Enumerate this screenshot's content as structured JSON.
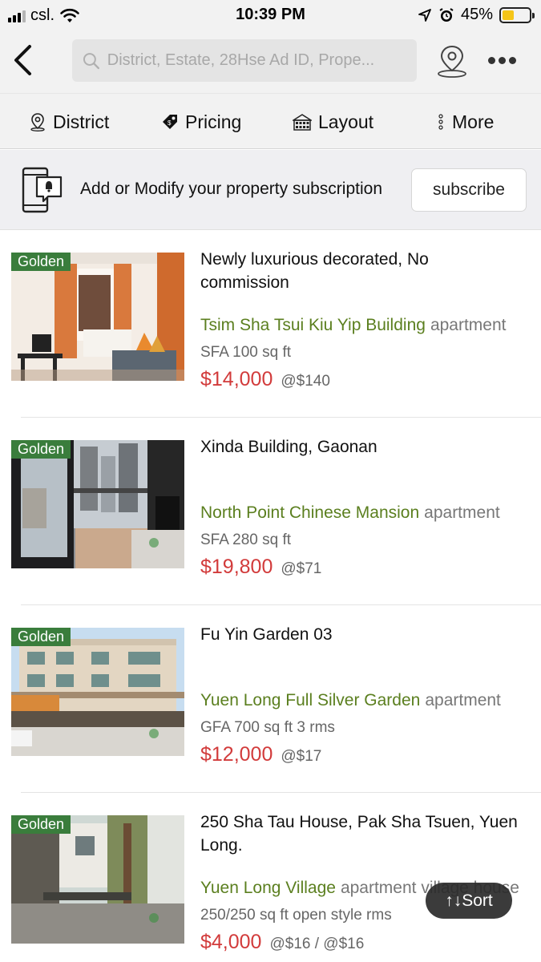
{
  "status_bar": {
    "carrier": "csl.",
    "time": "10:39 PM",
    "battery_percent_label": "45%",
    "battery_level": 0.45
  },
  "nav": {
    "search_placeholder": "District, Estate, 28Hse Ad ID, Prope..."
  },
  "filters": [
    {
      "label": "District",
      "icon": "location-pin-icon"
    },
    {
      "label": "Pricing",
      "icon": "price-tag-icon"
    },
    {
      "label": "Layout",
      "icon": "building-icon"
    },
    {
      "label": "More",
      "icon": "vertical-dots-icon"
    }
  ],
  "subscription": {
    "text": "Add or Modify your property subscription",
    "button_label": "subscribe"
  },
  "listings": [
    {
      "badge": "Golden",
      "title": "Newly luxurious decorated, No commission",
      "estate": "Tsim Sha Tsui Kiu Yip Building",
      "property_type": "apartment",
      "area": "SFA 100 sq ft",
      "price": "$14,000",
      "unit_price": "@$140"
    },
    {
      "badge": "Golden",
      "title": "Xinda Building, Gaonan",
      "estate": "North Point Chinese Mansion",
      "property_type": "apartment",
      "area": "SFA 280 sq ft",
      "price": "$19,800",
      "unit_price": "@$71"
    },
    {
      "badge": "Golden",
      "title": "Fu Yin Garden 03",
      "estate": "Yuen Long Full Silver Garden",
      "property_type": "apartment",
      "area": "GFA 700 sq ft 3 rms",
      "price": "$12,000",
      "unit_price": "@$17"
    },
    {
      "badge": "Golden",
      "title": "250 Sha Tau House, Pak Sha Tsuen, Yuen Long.",
      "estate": "Yuen Long Village",
      "property_type": "apartment village house",
      "area": "250/250 sq ft open style rms",
      "price": "$4,000",
      "unit_price": "@$16 / @$16"
    }
  ],
  "sort": {
    "label": "↑↓Sort"
  },
  "colors": {
    "badge_green": "#3a7d3c",
    "estate_green": "#5b7f1f",
    "price_red": "#d23b3b",
    "battery_yellow": "#f5c518"
  }
}
